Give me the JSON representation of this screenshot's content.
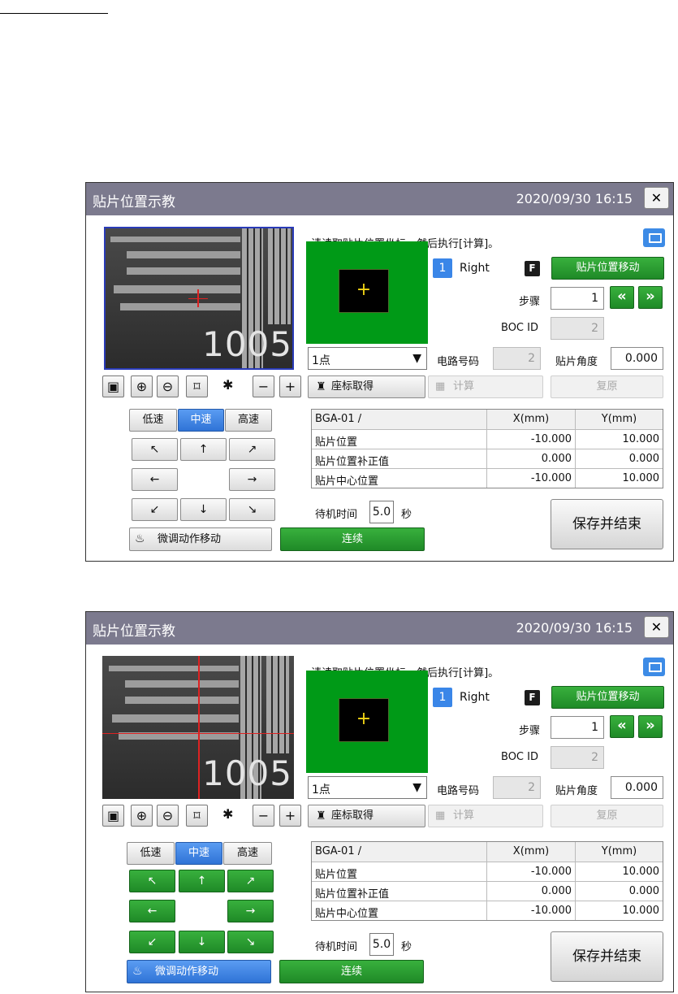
{
  "dialogs": [
    {
      "title": "贴片位置示教",
      "datetime": "2020/09/30 16:15",
      "close": "✕",
      "instruction": "请读取贴片位置坐标，然后执行[计算]。",
      "head_number": "1",
      "head_side": "Right",
      "f_badge": "F",
      "move_button": "贴片位置移动",
      "step_label": "步骤",
      "step_value": "1",
      "prev_icon": "«",
      "next_icon": "»",
      "boc_label": "BOC ID",
      "boc_value": "2",
      "point_select": "1点",
      "circuit_label": "电路号码",
      "circuit_value": "2",
      "angle_label": "贴片角度",
      "angle_value": "0.000",
      "camera_text": "1005",
      "crosshair": "+",
      "coord_get": "座标取得",
      "calculate": "计算",
      "restore": "复原",
      "speed": [
        "低速",
        "中速",
        "高速"
      ],
      "speed_selected": "中速",
      "arrows": [
        "↖",
        "↑",
        "↗",
        "←",
        "→",
        "↙",
        "↓",
        "↘"
      ],
      "jog_style": "gray",
      "fine_move": "微调动作移动",
      "fine_move_active": false,
      "continuous": "连续",
      "table": {
        "headers": [
          "BGA-01 /",
          "X(mm)",
          "Y(mm)"
        ],
        "rows": [
          [
            "贴片位置",
            "-10.000",
            "10.000"
          ],
          [
            "贴片位置补正值",
            "0.000",
            "0.000"
          ],
          [
            "贴片中心位置",
            "-10.000",
            "10.000"
          ]
        ]
      },
      "wait_label": "待机时间",
      "wait_value": "5.0",
      "wait_unit": "秒",
      "save": "保存并结束"
    },
    {
      "title": "贴片位置示教",
      "datetime": "2020/09/30 16:15",
      "close": "✕",
      "instruction": "请读取贴片位置坐标，然后执行[计算]。",
      "head_number": "1",
      "head_side": "Right",
      "f_badge": "F",
      "move_button": "贴片位置移动",
      "step_label": "步骤",
      "step_value": "1",
      "prev_icon": "«",
      "next_icon": "»",
      "boc_label": "BOC ID",
      "boc_value": "2",
      "point_select": "1点",
      "circuit_label": "电路号码",
      "circuit_value": "2",
      "angle_label": "贴片角度",
      "angle_value": "0.000",
      "camera_text": "1005",
      "crosshair": "+",
      "coord_get": "座标取得",
      "calculate": "计算",
      "restore": "复原",
      "speed": [
        "低速",
        "中速",
        "高速"
      ],
      "speed_selected": "中速",
      "arrows": [
        "↖",
        "↑",
        "↗",
        "←",
        "→",
        "↙",
        "↓",
        "↘"
      ],
      "jog_style": "green",
      "fine_move": "微调动作移动",
      "fine_move_active": true,
      "continuous": "连续",
      "table": {
        "headers": [
          "BGA-01 /",
          "X(mm)",
          "Y(mm)"
        ],
        "rows": [
          [
            "贴片位置",
            "-10.000",
            "10.000"
          ],
          [
            "贴片位置补正值",
            "0.000",
            "0.000"
          ],
          [
            "贴片中心位置",
            "-10.000",
            "10.000"
          ]
        ]
      },
      "wait_label": "待机时间",
      "wait_value": "5.0",
      "wait_unit": "秒",
      "save": "保存并结束"
    }
  ]
}
